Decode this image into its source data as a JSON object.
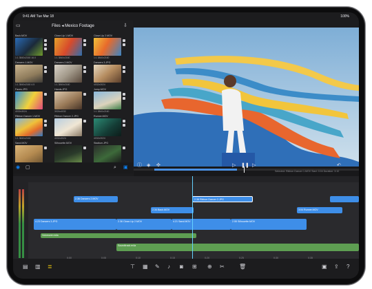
{
  "status_bar": {
    "time": "9:41 AM  Tue Mar 18",
    "battery": "100%"
  },
  "browser": {
    "title": "Files ◂ Mexico Footage",
    "clips": [
      {
        "name": "Back.MOV",
        "meta": "1:1  3840x2160  16.0"
      },
      {
        "name": "Close-Up 1.MOV",
        "meta": "1:1  3840x2160"
      },
      {
        "name": "Close-Up 2.MOV",
        "meta": "1:1  3840x2160"
      },
      {
        "name": "Dancers 1.MOV",
        "meta": "1:1  3840x2160  4.5"
      },
      {
        "name": "Dancers 2.MOV",
        "meta": "1:1  3840x2160"
      },
      {
        "name": "Dancers 3.JPG",
        "meta": "4032x3024"
      },
      {
        "name": "Faces.JPG",
        "meta": "4032x3024"
      },
      {
        "name": "Hands.JPG",
        "meta": "3024x4032"
      },
      {
        "name": "Jump.MOV",
        "meta": "1:1  3840x2160"
      },
      {
        "name": "Ribbon Dancer 1.MOV",
        "meta": "1:1  3840x2160"
      },
      {
        "name": "Ribbon Dancer 2.JPG",
        "meta": "4032x3024"
      },
      {
        "name": "Runner.MOV",
        "meta": "4032x3024"
      },
      {
        "name": "Sand.MOV",
        "meta": "1:1  3840x2160  4.3"
      },
      {
        "name": "Silhouette.MOV",
        "meta": "1:1  3840x2160"
      },
      {
        "name": "Stadium.JPG",
        "meta": "4032x3024"
      }
    ]
  },
  "viewer": {
    "info": "Selected: Ribbon Dancer 1.MOV  Start: 0:04  Duration: 3:10"
  },
  "timeline": {
    "clips": [
      {
        "label": "2.36  Dancers 2.MOV",
        "color": "#3e8ee8"
      },
      {
        "label": "2.38  Ribbon Dancer 2.JPG",
        "color": "#3e8ee8"
      },
      {
        "label": "2.34  Back.MOV",
        "color": "#3e8ee8"
      },
      {
        "label": "3:04  Runner.MOV",
        "color": "#3e8ee8"
      },
      {
        "label": "4.23  Dancers 3.JPG",
        "color": "#3e8ee8"
      },
      {
        "label": "2.36  Close-Up 2.MOV",
        "color": "#3e8ee8"
      },
      {
        "label": "4.21  Sand.MOV",
        "color": "#3e8ee8"
      },
      {
        "label": "2.55  Silhouette.MOV",
        "color": "#3e8ee8"
      },
      {
        "label": "Voiceover.m4a",
        "color": "#5e9e52"
      },
      {
        "label": "Soundtrack.m4a",
        "color": "#5e9e52"
      }
    ],
    "times": [
      "0:00",
      "0:05",
      "0:10",
      "0:15",
      "0:20",
      "0:25",
      "0:30",
      "0:35",
      "0:40",
      "0:45",
      "0:50"
    ],
    "playhead_time": "0:04"
  }
}
